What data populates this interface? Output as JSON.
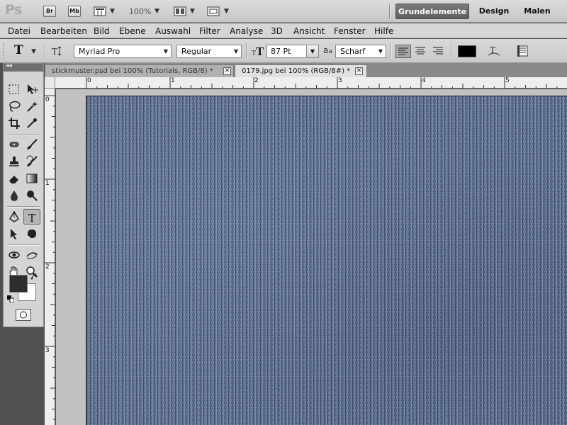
{
  "app_bar": {
    "logo": "Ps",
    "bridge_button": "Br",
    "minibridge_button": "Mb",
    "zoom": "100%",
    "workspaces": [
      "Grundelemente",
      "Design",
      "Malen"
    ],
    "active_workspace": "Grundelemente"
  },
  "menu": [
    "Datei",
    "Bearbeiten",
    "Bild",
    "Ebene",
    "Auswahl",
    "Filter",
    "Analyse",
    "3D",
    "Ansicht",
    "Fenster",
    "Hilfe"
  ],
  "options_bar": {
    "font_family": "Myriad Pro",
    "font_style": "Regular",
    "font_size": "87 Pt",
    "antialias_label": "a",
    "antialias_label_sub": "a",
    "antialias": "Scharf",
    "text_color": "#000000"
  },
  "toolbox": {
    "collapse_label": "◂◂",
    "foreground_color": "#2d2d2d",
    "background_color": "#ffffff"
  },
  "tabs": [
    {
      "label": "stickmuster.psd bei 100% (Tutorials, RGB/8) *",
      "active": false
    },
    {
      "label": "0179.jpg bei 100% (RGB/8#) *",
      "active": true
    }
  ],
  "tab_close": "✕",
  "rulers": {
    "horizontal": [
      "0",
      "1",
      "2",
      "3",
      "4",
      "5"
    ],
    "vertical": [
      "0",
      "1",
      "2",
      "3"
    ]
  },
  "canvas": {
    "texture": "blue knitted fabric",
    "base_color": "#5b6f8c"
  }
}
